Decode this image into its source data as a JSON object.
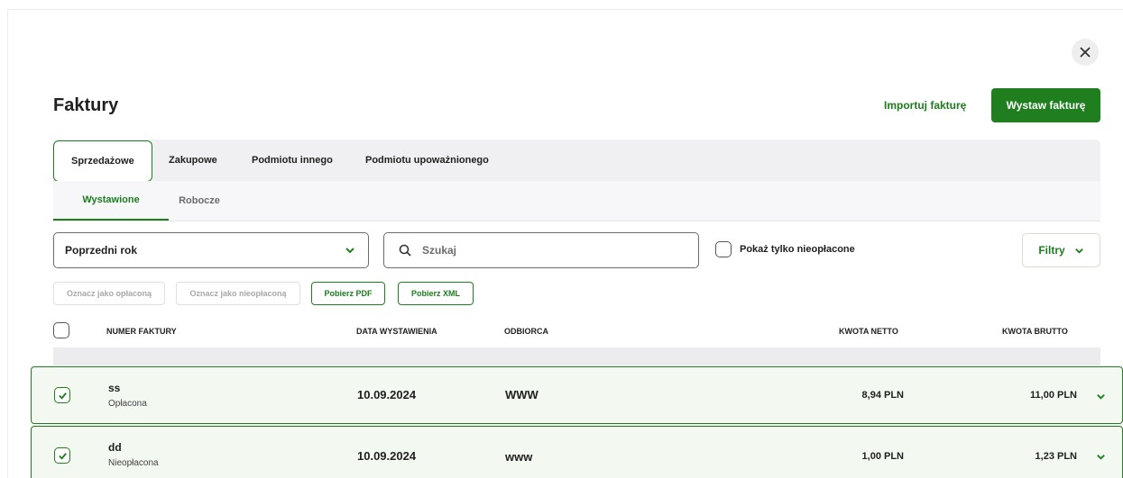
{
  "colors": {
    "accent": "#1f7f1f",
    "row_bg": "#f3f8f1",
    "tab_bg": "#f0f0f3"
  },
  "header": {
    "title": "Faktury",
    "import_label": "Importuj fakturę",
    "issue_label": "Wystaw fakturę",
    "close_icon": "close-icon"
  },
  "tabs_main": [
    {
      "label": "Sprzedażowe",
      "active": true
    },
    {
      "label": "Zakupowe",
      "active": false
    },
    {
      "label": "Podmiotu innego",
      "active": false
    },
    {
      "label": "Podmiotu upoważnionego",
      "active": false
    }
  ],
  "tabs_sub": [
    {
      "label": "Wystawione",
      "active": true
    },
    {
      "label": "Robocze",
      "active": false
    }
  ],
  "filters": {
    "period_value": "Poprzedni rok",
    "search_placeholder": "Szukaj",
    "unpaid_only_label": "Pokaż tylko nieopłacone",
    "filters_label": "Filtry"
  },
  "actions": {
    "mark_paid": "Oznacz jako opłaconą",
    "mark_unpaid": "Oznacz jako nieopłaconą",
    "download_pdf": "Pobierz PDF",
    "download_xml": "Pobierz XML"
  },
  "table": {
    "columns": [
      "NUMER FAKTURY",
      "DATA WYSTAWIENIA",
      "ODBIORCA",
      "KWOTA NETTO",
      "KWOTA BRUTTO"
    ],
    "rows": [
      {
        "number": "ss",
        "status": "Opłacona",
        "date": "10.09.2024",
        "recipient": "WWW",
        "net": "8,94 PLN",
        "gross": "11,00 PLN",
        "checked": true
      },
      {
        "number": "dd",
        "status": "Nieopłacona",
        "date": "10.09.2024",
        "recipient": "www",
        "net": "1,00 PLN",
        "gross": "1,23 PLN",
        "checked": true
      }
    ]
  }
}
